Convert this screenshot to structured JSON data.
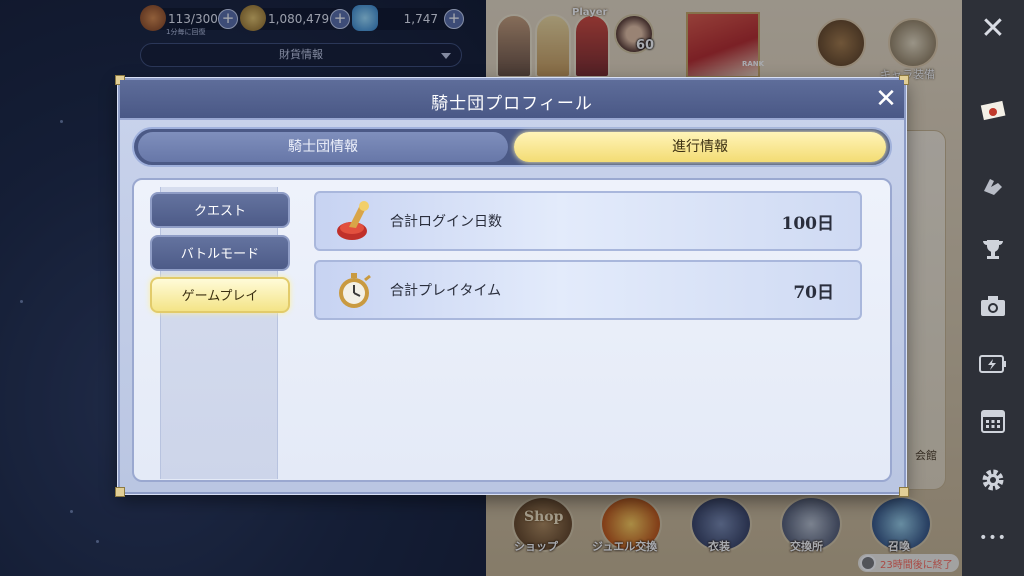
{
  "resources": {
    "stamina": "113/300",
    "stamina_sub": "1分毎に回復",
    "gold": "1,080,479",
    "gems": "1,747",
    "wallet_label": "財貨情報",
    "plus": "+"
  },
  "party": {
    "player_label": "Player",
    "player_level": "60",
    "rank_label": "RANK"
  },
  "top_menu": {
    "equip_label": "キャラ装備"
  },
  "hall_label": "会館",
  "bottom_menu": {
    "shop_word": "Shop",
    "shop": "ショップ",
    "jewel_exchange": "ジュエル交換",
    "costume": "衣装",
    "exchange": "交換所",
    "summon": "召喚",
    "timer": "23時間後に終了"
  },
  "dialog": {
    "title": "騎士団プロフィール",
    "close": "✕",
    "tabs": [
      "騎士団情報",
      "進行情報"
    ],
    "active_tab": 1,
    "side_nav": [
      "クエスト",
      "バトルモード",
      "ゲームプレイ"
    ],
    "active_nav": 2,
    "rows": [
      {
        "label": "合計ログイン日数",
        "value": "100日",
        "icon": "trophy-icon"
      },
      {
        "label": "合計プレイタイム",
        "value": "70日",
        "icon": "stopwatch-icon"
      }
    ]
  },
  "sidebar": {
    "close": "✕",
    "items": [
      "mail-icon",
      "gauntlet-icon",
      "trophy-icon",
      "camera-icon",
      "battery-icon",
      "calendar-icon",
      "gear-icon",
      "more-icon"
    ],
    "more": "•••"
  },
  "colors": {
    "dialog_title_bar": "#4a5886",
    "active_gold": "#f3dc74",
    "sidebar_bg": "#2d3038"
  }
}
